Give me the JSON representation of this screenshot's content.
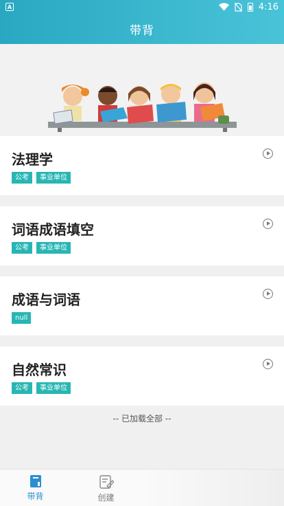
{
  "status_bar": {
    "time": "4:16",
    "left_icon": "A"
  },
  "header": {
    "title": "带背"
  },
  "cards": [
    {
      "title": "法理学",
      "tags": [
        "公考",
        "事业单位"
      ]
    },
    {
      "title": "词语成语填空",
      "tags": [
        "公考",
        "事业单位"
      ]
    },
    {
      "title": "成语与词语",
      "tags": [
        "null"
      ]
    },
    {
      "title": "自然常识",
      "tags": [
        "公考",
        "事业单位"
      ]
    }
  ],
  "footer_text": "-- 已加载全部 --",
  "tabbar": {
    "tab1": "带背",
    "tab2": "创建"
  },
  "colors": {
    "header": "#2aa8c2",
    "tag": "#27b6b4",
    "active_tab": "#2a8fd0"
  }
}
